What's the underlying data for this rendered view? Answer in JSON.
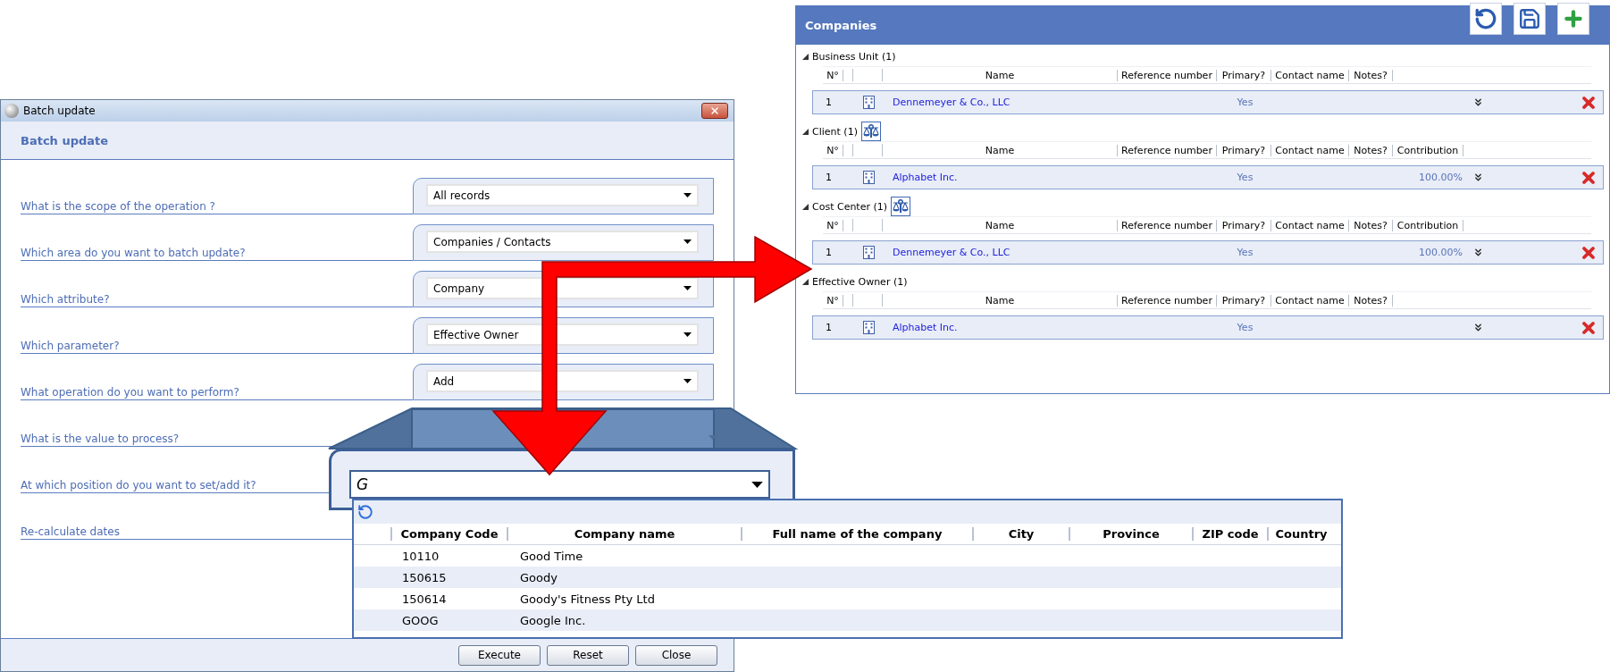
{
  "batch_dialog": {
    "title": "Batch update",
    "heading": "Batch update",
    "questions": [
      {
        "label": "What is the scope of the operation ?",
        "value": "All records"
      },
      {
        "label": "Which area do you want to batch update?",
        "value": "Companies / Contacts"
      },
      {
        "label": "Which attribute?",
        "value": "Company"
      },
      {
        "label": "Which parameter?",
        "value": "Effective Owner"
      },
      {
        "label": "What operation do you want to perform?",
        "value": "Add"
      },
      {
        "label": "What is the value to process?"
      },
      {
        "label": "At which position do you want to set/add it?"
      },
      {
        "label": "Re-calculate dates"
      }
    ],
    "buttons": [
      "Execute",
      "Reset",
      "Close"
    ]
  },
  "value_callout": {
    "value": "G"
  },
  "lookup": {
    "columns": [
      "Company Code",
      "Company name",
      "Full name of the company",
      "City",
      "Province",
      "ZIP code",
      "Country"
    ],
    "rows": [
      {
        "code": "10110",
        "name": "Good Time"
      },
      {
        "code": "150615",
        "name": "Goody"
      },
      {
        "code": "150614",
        "name": "Goody's Fitness Pty Ltd"
      },
      {
        "code": "GOOG",
        "name": "Google Inc."
      }
    ]
  },
  "companies": {
    "title": "Companies",
    "sections": [
      {
        "title": "Business Unit (1)",
        "expanded": true,
        "scale_button": false,
        "columns": [
          "N°",
          "Name",
          "Reference number",
          "Primary?",
          "Contact name",
          "Notes?"
        ],
        "rows": [
          {
            "number": "1",
            "name": "Dennemeyer & Co., LLC",
            "primary": "Yes"
          }
        ]
      },
      {
        "title": "Client (1)",
        "expanded": true,
        "scale_button": true,
        "columns": [
          "N°",
          "Name",
          "Reference number",
          "Primary?",
          "Contact name",
          "Notes?",
          "Contribution"
        ],
        "rows": [
          {
            "number": "1",
            "name": "Alphabet Inc.",
            "primary": "Yes",
            "contribution": "100.00%"
          }
        ]
      },
      {
        "title": "Cost Center (1)",
        "expanded": true,
        "scale_button": true,
        "columns": [
          "N°",
          "Name",
          "Reference number",
          "Primary?",
          "Contact name",
          "Notes?",
          "Contribution"
        ],
        "rows": [
          {
            "number": "1",
            "name": "Dennemeyer & Co., LLC",
            "primary": "Yes",
            "contribution": "100.00%"
          }
        ]
      },
      {
        "title": "Effective Owner (1)",
        "expanded": true,
        "scale_button": false,
        "columns": [
          "N°",
          "Name",
          "Reference number",
          "Primary?",
          "Contact name",
          "Notes?"
        ],
        "rows": [
          {
            "number": "1",
            "name": "Alphabet Inc.",
            "primary": "Yes"
          }
        ]
      }
    ]
  }
}
